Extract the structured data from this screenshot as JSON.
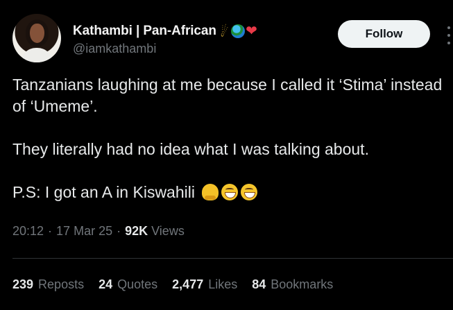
{
  "author": {
    "display_name": "Kathambi | Pan-African",
    "handle": "@iamkathambi",
    "emojis": [
      "comet-emoji",
      "globe-emoji",
      "red-heart-emoji"
    ]
  },
  "actions": {
    "follow_label": "Follow",
    "more_icon": "more-vertical-icon"
  },
  "tweet": {
    "paragraph_1": "Tanzanians laughing at me because I called it ‘Stima’ instead of ‘Umeme’.",
    "paragraph_2": "They literally had no idea what I was talking about.",
    "paragraph_3": "P.S: I got an A in Kiswahili",
    "trailing_emojis": [
      "melting-face-emoji",
      "grinning-squinting-face-emoji",
      "grinning-squinting-face-emoji"
    ]
  },
  "meta": {
    "time": "20:12",
    "date": "17 Mar 25",
    "separator": "·",
    "views_count": "92K",
    "views_label": "Views"
  },
  "stats": [
    {
      "count": "239",
      "label": "Reposts"
    },
    {
      "count": "24",
      "label": "Quotes"
    },
    {
      "count": "2,477",
      "label": "Likes"
    },
    {
      "count": "84",
      "label": "Bookmarks"
    }
  ],
  "colors": {
    "background": "#000000",
    "text": "#e7e9ea",
    "secondary_text": "#71767b",
    "button_bg": "#eff3f4",
    "divider": "#2f3336"
  }
}
